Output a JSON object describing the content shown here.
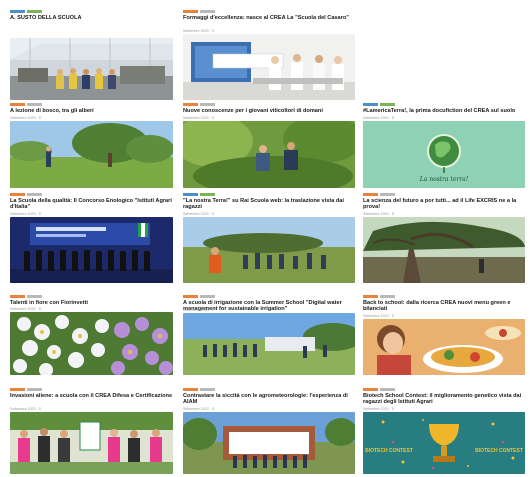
{
  "colors": {
    "tag_orange": "#e8833a",
    "tag_blue": "#4a8fc9",
    "tag_green": "#7bb454",
    "tag_grey": "#b9b9b9"
  },
  "cards": [
    {
      "title": "A. SUSTO DELLA SCUOLA",
      "meta": ""
    },
    {
      "title": "Formaggi d'eccellenza: nasce al CREA La \"Scuola del Casaro\"",
      "meta": "Settembre 2023 · 5'"
    },
    {
      "title": "A lezione di bosco, tra gli alberi",
      "meta": "Settembre 2023 · 5'"
    },
    {
      "title": "Nuove conoscenze per i giovani viticoltori di domani",
      "meta": "Settembre 2023 · 5'"
    },
    {
      "title": "#LamericaTerra!, la prima docufiction del CREA sul suolo",
      "meta": "Settembre 2023 · 5'",
      "image_text": "La nostra terra!"
    },
    {
      "title": "La Scuola della qualità: Il Concorso Enologico \"Istituti Agrari d'Italia\"",
      "meta": "Settembre 2023 · 5'"
    },
    {
      "title": "\"La nostra Terra!\" su Rai Scuola web: la traslazione vista dai ragazzi",
      "meta": "Settembre 2023 · 5'"
    },
    {
      "title": "La scienza del futuro a por tutti... ad il Life EXCRIS ne a la prova!",
      "meta": "Settembre 2023 · 5'"
    },
    {
      "title": "Talenti in fiore con Fiorinvetti",
      "meta": "Settembre 2023 · 5'"
    },
    {
      "title": "A scuola di irrigazione con la Summer School \"Digital water management for sustainable irrigation\"",
      "meta": "Settembre 2023 · 5'"
    },
    {
      "title": "Back to school: dalla ricerca CREA nuovi menu green e bilanciati",
      "meta": "Settembre 2023 · 5'"
    },
    {
      "title": "Invasioni aliene: a scuola con il CREA Difesa e Certificazione",
      "meta": "Settembre 2023 · 5'"
    },
    {
      "title": "Contrastare la siccità con le agrometeorologie: l'esperienza di AIAM",
      "meta": "Settembre 2023 · 5'"
    },
    {
      "title": "Biotech School Contest: il miglioramento genetico vista dai ragazzi degli Istituti Agrari",
      "meta": "Settembre 2023 · 5'",
      "image_text_left": "BIOTECH CONTEST",
      "image_text_right": "BIOTECH CONTEST"
    }
  ]
}
